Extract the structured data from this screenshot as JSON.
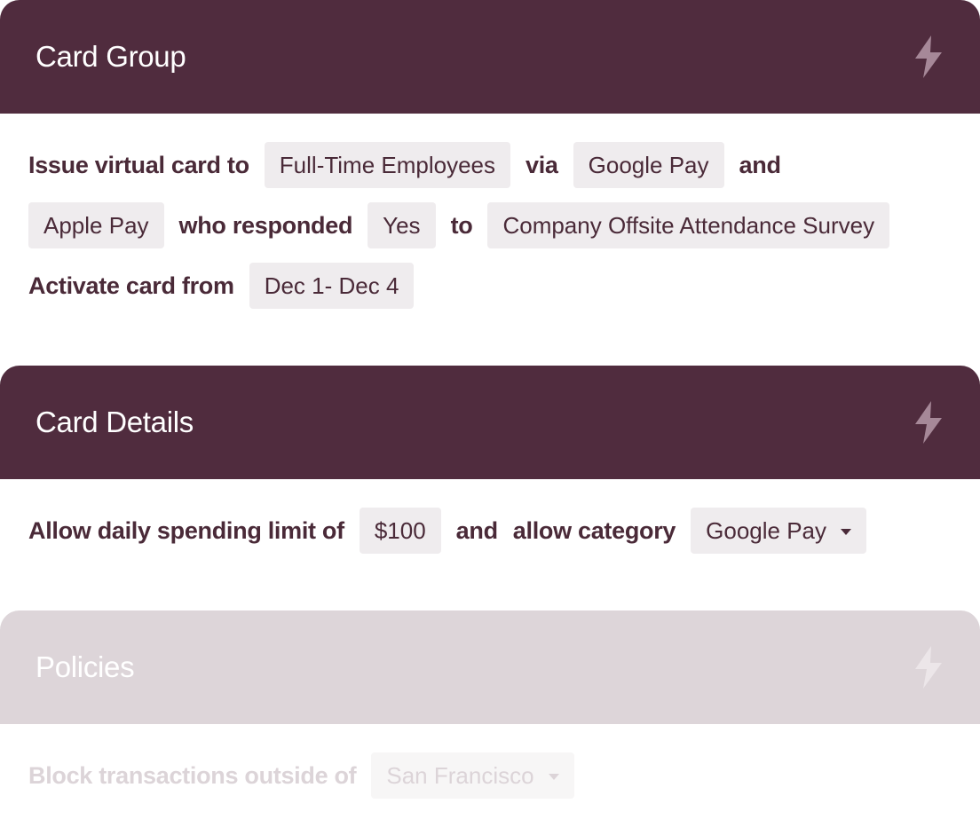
{
  "sections": [
    {
      "title": "Card Group",
      "icon": "bolt-icon",
      "rows": [
        [
          "Issue virtual card to",
          "Full-Time Employees",
          "via",
          "Google Pay",
          "and"
        ],
        [
          "Apple Pay",
          "who responded",
          "Yes",
          "to",
          "Company Offsite Attendance Survey"
        ],
        [
          "Activate card from",
          "Dec 1- Dec 4"
        ]
      ]
    },
    {
      "title": "Card Details",
      "icon": "bolt-icon",
      "rows": [
        [
          "Allow daily spending limit of",
          "$100",
          "and",
          "allow category",
          "Google Pay"
        ]
      ]
    },
    {
      "title": "Policies",
      "icon": "bolt-icon",
      "rows": [
        [
          "Block transactions outside of",
          "San Francisco"
        ]
      ]
    }
  ],
  "colors": {
    "header": "#502c3e",
    "header_disabled": "#ddd5d9",
    "text": "#4a2a38",
    "chip": "#efecee",
    "bolt": "#a68898"
  }
}
